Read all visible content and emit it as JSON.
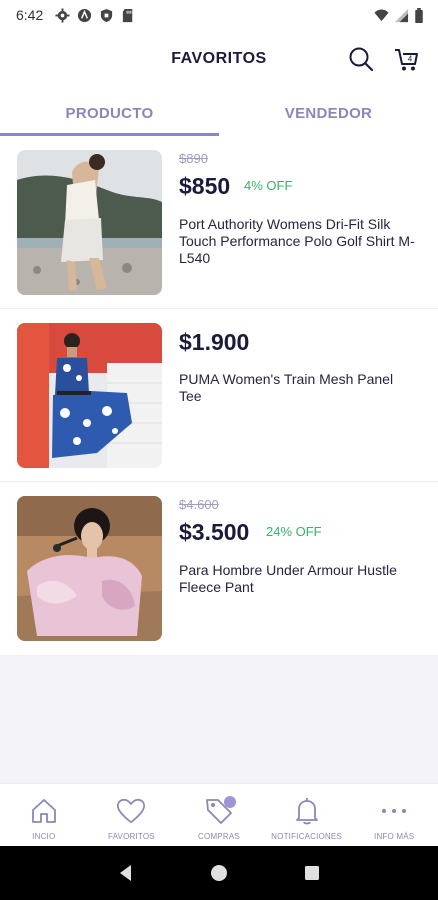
{
  "status_bar": {
    "time": "6:42"
  },
  "header": {
    "title": "FAVORITOS",
    "cart_count": "4"
  },
  "tabs": [
    {
      "label": "PRODUCTO",
      "active": true
    },
    {
      "label": "VENDEDOR",
      "active": false
    }
  ],
  "products": [
    {
      "old_price": "$890",
      "price": "$850",
      "discount": "4% OFF",
      "title": "Port Authority Womens Dri-Fit Silk Touch Performance Polo Golf Shirt M-L540"
    },
    {
      "old_price": "",
      "price": "$1.900",
      "discount": "",
      "title": "PUMA Women's Train Mesh Panel Tee"
    },
    {
      "old_price": "$4.600",
      "price": "$3.500",
      "discount": "24% OFF",
      "title": "Para Hombre Under Armour Hustle Fleece Pant"
    }
  ],
  "bottom_nav": [
    {
      "label": "INCIO",
      "icon": "home-icon"
    },
    {
      "label": "FAVORITOS",
      "icon": "heart-icon"
    },
    {
      "label": "COMPRAS",
      "icon": "tag-icon"
    },
    {
      "label": "NOTIFICACIONES",
      "icon": "bell-icon"
    },
    {
      "label": "INFO MÁS",
      "icon": "more-icon"
    }
  ],
  "colors": {
    "accent": "#8a87c8",
    "discount": "#35b36a",
    "text": "#1b1a3a"
  }
}
